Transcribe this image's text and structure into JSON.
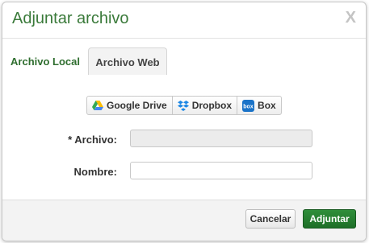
{
  "dialog": {
    "title": "Adjuntar archivo",
    "close_label": "X"
  },
  "tabs": [
    {
      "label": "Archivo Local",
      "active": false
    },
    {
      "label": "Archivo Web",
      "active": true
    }
  ],
  "providers": [
    {
      "label": "Google Drive",
      "icon": "google-drive-icon"
    },
    {
      "label": "Dropbox",
      "icon": "dropbox-icon"
    },
    {
      "label": "Box",
      "icon": "box-icon"
    }
  ],
  "form": {
    "archivo_label": "* Archivo:",
    "archivo_value": "",
    "nombre_label": "Nombre:",
    "nombre_value": ""
  },
  "footer": {
    "cancel_label": "Cancelar",
    "attach_label": "Adjuntar"
  },
  "colors": {
    "accent": "#2f6e2f",
    "primary_button": "#1e6f28",
    "box_blue": "#1a73c8",
    "dropbox_blue": "#1e88e5"
  }
}
